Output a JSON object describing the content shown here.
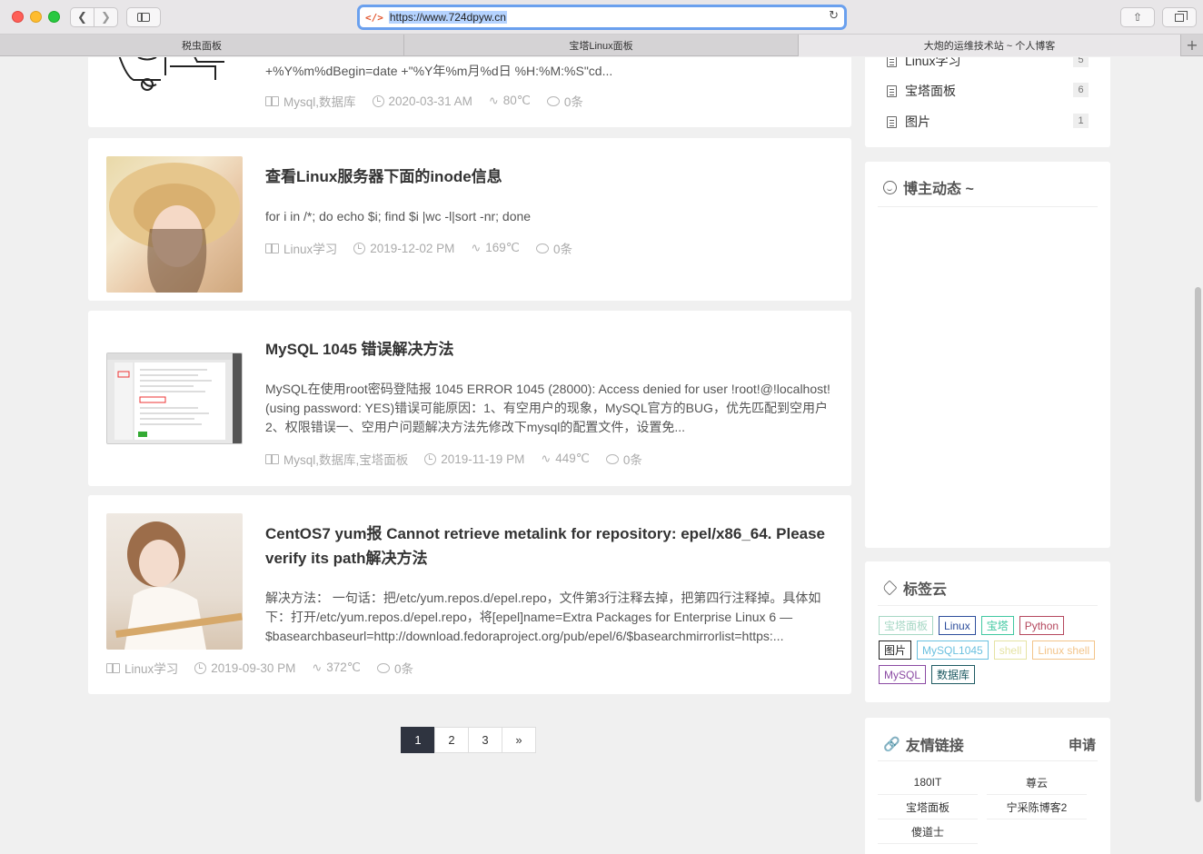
{
  "browser": {
    "url": "https://www.724dpyw.cn",
    "tabs": [
      "税虫面板",
      "宝塔Linux面板",
      "大炮的运维技术站 ~ 个人博客"
    ]
  },
  "posts": [
    {
      "title": "",
      "excerpt": "+%Y%m%dBegin=date +\"%Y年%m月%d日 %H:%M:%S\"cd...",
      "category": "Mysql,数据库",
      "date": "2020-03-31 AM",
      "views": "80℃",
      "comments": "0条"
    },
    {
      "title": "查看Linux服务器下面的inode信息",
      "excerpt": "for i in /*; do echo $i; find $i |wc -l|sort -nr; done",
      "category": "Linux学习",
      "date": "2019-12-02 PM",
      "views": "169℃",
      "comments": "0条"
    },
    {
      "title": "MySQL 1045 错误解决方法",
      "excerpt": "MySQL在使用root密码登陆报 1045 ERROR 1045 (28000): Access denied for user !root!@!localhost! (using password: YES)错误可能原因：1、有空用户的现象，MySQL官方的BUG，优先匹配到空用户2、权限错误一、空用户问题解决方法先修改下mysql的配置文件，设置免...",
      "category": "Mysql,数据库,宝塔面板",
      "date": "2019-11-19 PM",
      "views": "449℃",
      "comments": "0条"
    },
    {
      "title": "CentOS7 yum报 Cannot retrieve metalink for repository: epel/x86_64. Please verify its path解决方法",
      "excerpt": "解决方法： 一句话：把/etc/yum.repos.d/epel.repo，文件第3行注释去掉，把第四行注释掉。具体如下：打开/etc/yum.repos.d/epel.repo，将[epel]name=Extra Packages for Enterprise Linux 6 — $basearchbaseurl=http://download.fedoraproject.org/pub/epel/6/$basearchmirrorlist=https:...",
      "category": "Linux学习",
      "date": "2019-09-30 PM",
      "views": "372℃",
      "comments": "0条"
    }
  ],
  "pagination": {
    "pages": [
      "1",
      "2",
      "3"
    ],
    "next": "»",
    "current": "1"
  },
  "sidebar": {
    "categories": [
      {
        "name": "Linux学习",
        "count": "5"
      },
      {
        "name": "宝塔面板",
        "count": "6"
      },
      {
        "name": "图片",
        "count": "1"
      }
    ],
    "dynamics_title": "博主动态 ~",
    "tagcloud_title": "标签云",
    "tags": [
      {
        "label": "宝塔面板",
        "color": "#a6d7c4"
      },
      {
        "label": "Linux",
        "color": "#2d4e9c"
      },
      {
        "label": "宝塔",
        "color": "#41c8a1"
      },
      {
        "label": "Python",
        "color": "#b5485e"
      },
      {
        "label": "图片",
        "color": "#222222"
      },
      {
        "label": "MySQL1045",
        "color": "#6bc0df"
      },
      {
        "label": "shell",
        "color": "#e5e3a3"
      },
      {
        "label": "Linux shell",
        "color": "#f3c48a"
      },
      {
        "label": "MySQL",
        "color": "#8b4aa3"
      },
      {
        "label": "数据库",
        "color": "#1e5a62"
      }
    ],
    "links_title": "友情链接",
    "links_apply": "申请",
    "links": [
      "180IT",
      "尊云",
      "宝塔面板",
      "宁采陈博客2",
      "傻道士"
    ]
  }
}
